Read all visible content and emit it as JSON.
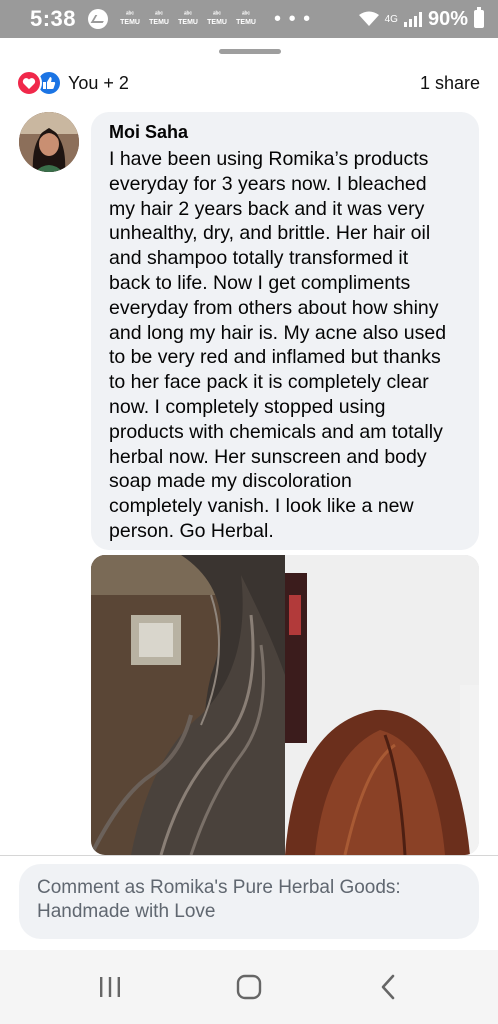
{
  "status_bar": {
    "time": "5:38",
    "notification_icons": [
      "TEMU",
      "TEMU",
      "TEMU",
      "TEMU",
      "TEMU"
    ],
    "overflow_indicator": "• • •",
    "network": "4G",
    "battery": "90%"
  },
  "reactions": {
    "text": "You + 2",
    "shares": "1 share",
    "icons": [
      "love-icon",
      "like-icon"
    ],
    "love_color": "#f0284a",
    "like_color": "#1b74e4"
  },
  "comment": {
    "author": "Moi Saha",
    "text_lines": [
      "I have been using Romika’s products",
      "everyday for 3 years now. I bleached",
      "my hair 2 years back and it was very",
      "unhealthy, dry, and brittle. Her hair oil",
      "and shampoo totally transformed it",
      "back to life. Now I get compliments",
      "everyday from others about how shiny",
      "and long my hair is. My acne also used",
      "to be very red and inflamed but thanks",
      "to her face pack it is completely clear",
      "now. I completely stopped using",
      "products with chemicals and am totally",
      "herbal now. Her sunscreen and body",
      "soap made my discoloration",
      "completely vanish. I look like a new",
      "person. Go Herbal."
    ]
  },
  "comment_input": {
    "placeholder_line1": "Comment as Romika's Pure Herbal Goods:",
    "placeholder_line2": "Handmade with Love"
  },
  "nav": {
    "buttons": [
      "recent-apps-icon",
      "home-icon",
      "back-icon"
    ]
  }
}
